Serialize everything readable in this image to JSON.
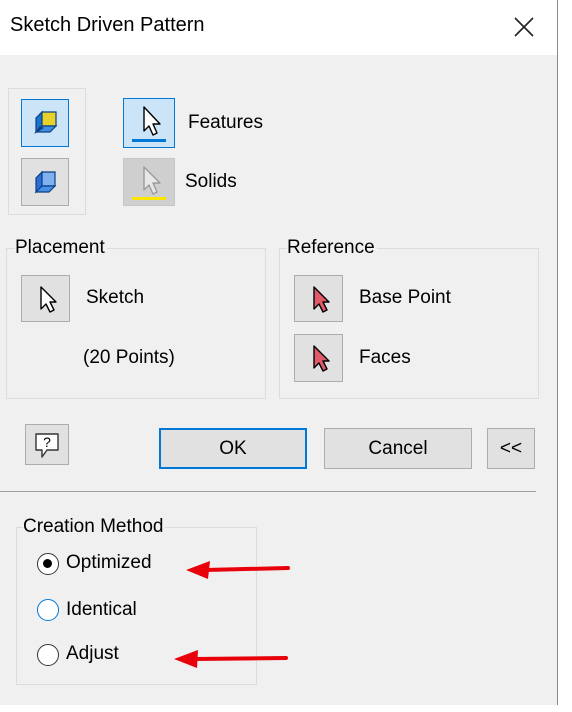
{
  "window": {
    "title": "Sketch Driven Pattern",
    "close_symbol": "✕"
  },
  "mode": {
    "features_label": "Features",
    "solids_label": "Solids"
  },
  "placement": {
    "title": "Placement",
    "sketch_label": "Sketch",
    "points_text": "(20 Points)"
  },
  "reference": {
    "title": "Reference",
    "base_point_label": "Base Point",
    "faces_label": "Faces"
  },
  "actions": {
    "ok_label": "OK",
    "cancel_label": "Cancel",
    "more_label": "<<"
  },
  "creation_method": {
    "title": "Creation Method",
    "options": [
      {
        "label": "Optimized",
        "selected": true
      },
      {
        "label": "Identical",
        "selected": false
      },
      {
        "label": "Adjust",
        "selected": false
      }
    ]
  },
  "colors": {
    "accent": "#0078d7",
    "features_underline": "#0078d7",
    "solids_underline": "#ffe600",
    "annotation_arrow": "#e8000b",
    "reference_cursor": "#e05a6a"
  },
  "icons": {
    "pattern_features": "pattern-features-icon",
    "pattern_solids": "pattern-solids-icon",
    "select": "select-cursor-icon",
    "help": "help-icon"
  }
}
